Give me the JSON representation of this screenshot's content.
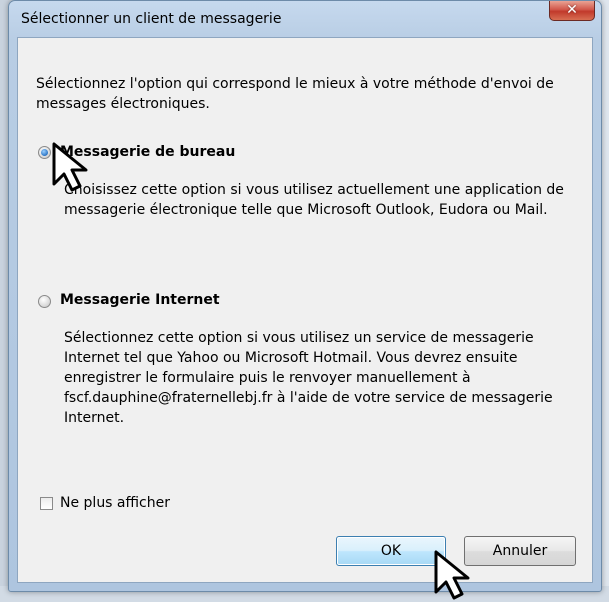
{
  "dialog": {
    "title": "Sélectionner un client de messagerie",
    "close_glyph": "✕",
    "intro": "Sélectionnez l'option qui correspond le mieux à votre méthode d'envoi de messages électroniques.",
    "options": [
      {
        "label": "Messagerie de bureau",
        "selected": true,
        "description": "Choisissez cette option si vous utilisez actuellement une application de messagerie électronique telle que Microsoft Outlook, Eudora ou Mail."
      },
      {
        "label": "Messagerie Internet",
        "selected": false,
        "description": "Sélectionnez cette option si vous utilisez un service de messagerie Internet tel que Yahoo ou Microsoft Hotmail. Vous devrez ensuite enregistrer le formulaire puis le renvoyer manuellement à fscf.dauphine@fraternellebj.fr à l'aide de votre service de messagerie Internet."
      }
    ],
    "dont_show_again": {
      "label": "Ne plus afficher",
      "checked": false
    },
    "buttons": {
      "ok": "OK",
      "cancel": "Annuler"
    }
  },
  "icons": [
    "close-icon",
    "mouse-pointer-icon"
  ],
  "colors": {
    "titlebar": "#b8cde4",
    "close_button": "#c1392b",
    "default_button_border": "#3c7fb1"
  }
}
